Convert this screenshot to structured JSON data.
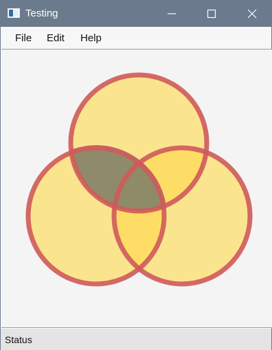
{
  "window": {
    "title": "Testing"
  },
  "menu": {
    "items": [
      "File",
      "Edit",
      "Help"
    ]
  },
  "status": {
    "text": "Status"
  },
  "diagram": {
    "circle_fill": "#ffd94a",
    "circle_stroke": "#cf5a5a",
    "overlap_dark": "#7d7d6a",
    "overlap_edge": "#6b4f8a"
  },
  "colors": {
    "titlebar": "#6b7a8c",
    "canvas": "#f4f4f4",
    "statusbar": "#e4e4e4"
  }
}
